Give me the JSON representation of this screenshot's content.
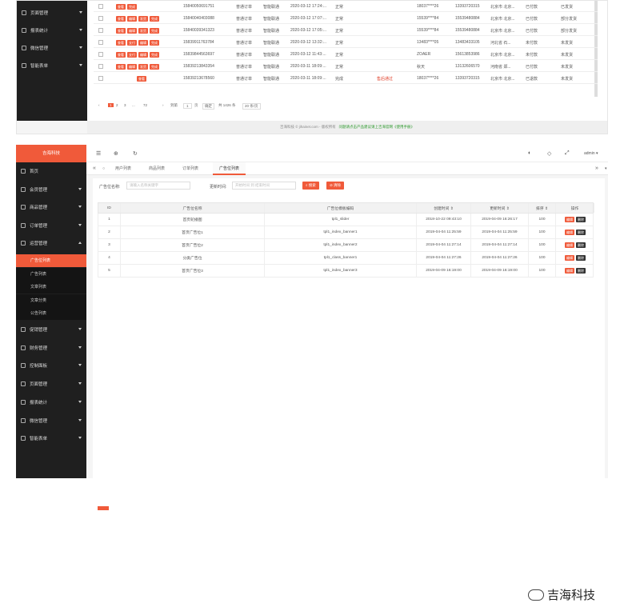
{
  "top_sidebar": [
    {
      "label": "页面管理",
      "icon": "link-icon"
    },
    {
      "label": "报表统计",
      "icon": "chart-icon"
    },
    {
      "label": "微信管理",
      "icon": "wechat-icon"
    },
    {
      "label": "智能表单",
      "icon": "form-icon"
    }
  ],
  "top_rows": [
    {
      "btns": [
        "查看",
        "完成"
      ],
      "phone1": "15840050691751",
      "type": "普通订单",
      "mode": "智能联通",
      "time": "2020-03-12 17:24:...",
      "status": "正常",
      "tag": "",
      "mask": "18037****26",
      "phone2": "13393720315",
      "city": "北京市 北京...",
      "pay": "已付款",
      "ship": "已发货"
    },
    {
      "btns": [
        "查看",
        "编辑",
        "发货",
        "完成"
      ],
      "phone1": "15840040403088",
      "type": "普通订单",
      "mode": "智能联通",
      "time": "2020-03-12 17:07:...",
      "status": "正常",
      "tag": "",
      "mask": "15539****84",
      "phone2": "15539480884",
      "city": "北京市 北京...",
      "pay": "已付款",
      "ship": "部分发货"
    },
    {
      "btns": [
        "查看",
        "编辑",
        "发货",
        "完成"
      ],
      "phone1": "15840039341323",
      "type": "普通订单",
      "mode": "智能联通",
      "time": "2020-03-12 17:05:...",
      "status": "正常",
      "tag": "",
      "mask": "15539****84",
      "phone2": "15539480884",
      "city": "北京市 北京...",
      "pay": "已付款",
      "ship": "部分发货"
    },
    {
      "btns": [
        "查看",
        "支付",
        "编辑",
        "完成"
      ],
      "phone1": "15839911763784",
      "type": "普通订单",
      "mode": "智能联通",
      "time": "2020-03-12 13:32:...",
      "status": "正常",
      "tag": "",
      "mask": "13483****05",
      "phone2": "13483433105",
      "city": "河北省 石...",
      "pay": "未付款",
      "ship": "未发货"
    },
    {
      "btns": [
        "查看",
        "支付",
        "编辑",
        "完成"
      ],
      "phone1": "15839844563697",
      "type": "普通订单",
      "mode": "智能联通",
      "time": "2020-03-12 11:43:...",
      "status": "正常",
      "tag": "",
      "mask": "ZOAER",
      "phone2": "15613853986",
      "city": "北京市 北京...",
      "pay": "未付款",
      "ship": "未发货"
    },
    {
      "btns": [
        "查看",
        "编辑",
        "发货",
        "完成"
      ],
      "phone1": "15839213843354",
      "type": "普通订单",
      "mode": "智能联通",
      "time": "2020-03-11 18:09:...",
      "status": "正常",
      "tag": "",
      "mask": "秋天",
      "phone2": "13132606570",
      "city": "河南省 郑...",
      "pay": "已付款",
      "ship": "未发货"
    },
    {
      "btns": [
        "查看"
      ],
      "phone1": "15839213678560",
      "type": "普通订单",
      "mode": "智能联通",
      "time": "2020-03-11 18:09:...",
      "status": "完成",
      "tag": "售后通过",
      "mask": "18037****26",
      "phone2": "13393720315",
      "city": "北京市 北京...",
      "pay": "已退款",
      "ship": "未发货"
    }
  ],
  "top_pager": {
    "pages": [
      "1",
      "2",
      "3",
      "...",
      "72"
    ],
    "jump_label": "到第",
    "page_value": "1",
    "page_unit": "页",
    "confirm": "确定",
    "total": "共 1426 条",
    "per_page": "20 条/页"
  },
  "top_footer": {
    "text": "吉海科技 © jihainet.com - 版权所有",
    "link": "问题请点击产品建议请上吉海官网《使用手册》"
  },
  "logo": "吉海科技",
  "sidebar": {
    "items": [
      {
        "label": "首页",
        "icon": "home-icon",
        "arrow": false
      },
      {
        "label": "会员管理",
        "icon": "user-icon",
        "arrow": true
      },
      {
        "label": "商品管理",
        "icon": "goods-icon",
        "arrow": true
      },
      {
        "label": "订单管理",
        "icon": "order-icon",
        "arrow": true
      },
      {
        "label": "运营管理",
        "icon": "operate-icon",
        "arrow": true,
        "open": true
      }
    ],
    "sub": [
      {
        "label": "广告位列表",
        "active": true
      },
      {
        "label": "广告列表"
      },
      {
        "label": "文章列表"
      },
      {
        "label": "文章分类"
      },
      {
        "label": "公告列表"
      }
    ],
    "items2": [
      {
        "label": "促销管理",
        "icon": "promo-icon"
      },
      {
        "label": "财务管理",
        "icon": "finance-icon"
      },
      {
        "label": "控制面板",
        "icon": "panel-icon"
      },
      {
        "label": "页面管理",
        "icon": "link-icon"
      },
      {
        "label": "报表统计",
        "icon": "chart-icon"
      },
      {
        "label": "微信管理",
        "icon": "wechat-icon"
      },
      {
        "label": "智能表单",
        "icon": "form-icon"
      }
    ]
  },
  "topbar": {
    "user": "admin"
  },
  "tabs": [
    "用户列表",
    "商品列表",
    "订单列表",
    "广告位列表"
  ],
  "filter": {
    "name_label": "广告位名称:",
    "name_placeholder": "请输入名称关键字",
    "time_label": "更新时间:",
    "time_placeholder": "开始时间 到 结束时间",
    "search": "搜索",
    "reset": "清除"
  },
  "table": {
    "headers": [
      "ID",
      "广告位名称",
      "广告位模板编码",
      "创建时间 ⇕",
      "更新时间 ⇕",
      "排序 ⇕",
      "操作"
    ],
    "rows": [
      [
        "1",
        "首页轮播图",
        "tpl1_slider",
        "2018-10-22 09:43:10",
        "2019-04-09 16:26:17",
        "100"
      ],
      [
        "2",
        "首页广告位1",
        "tpl1_index_banner1",
        "2019-04-04 11:25:59",
        "2019-04-04 11:25:59",
        "100"
      ],
      [
        "3",
        "首页广告位2",
        "tpl1_index_banner2",
        "2019-04-04 11:27:14",
        "2019-04-04 11:27:14",
        "100"
      ],
      [
        "4",
        "分类广告位",
        "tpl1_class_banner1",
        "2019-04-04 11:27:26",
        "2019-04-04 11:27:26",
        "100"
      ],
      [
        "5",
        "首页广告位3",
        "tpl1_index_banner3",
        "2019-04-09 16:19:00",
        "2019-04-09 16:19:00",
        "100"
      ]
    ],
    "edit": "编辑",
    "del": "删除"
  },
  "watermark": "吉海科技",
  "colors": {
    "accent": "#f05a3a",
    "sidebar": "#1f1f1f"
  }
}
